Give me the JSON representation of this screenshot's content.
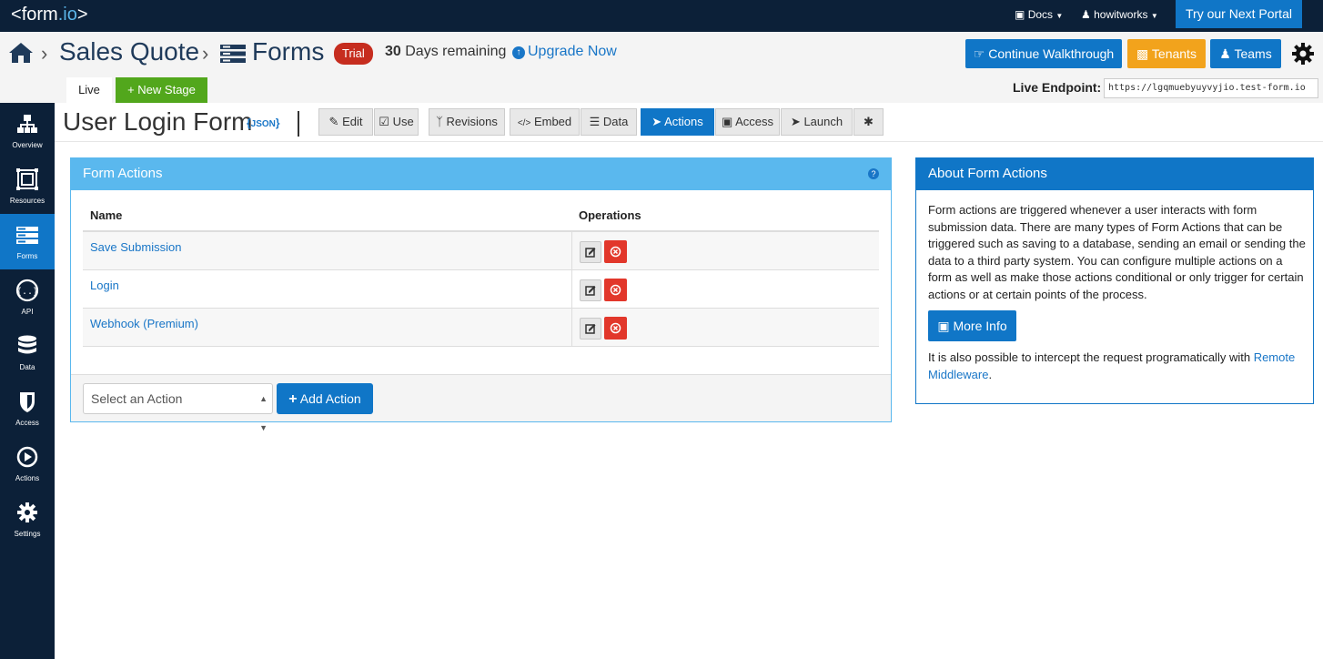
{
  "topbar": {
    "logo_prefix": "<",
    "logo_brand": "form",
    "logo_io": ".io",
    "logo_suffix": ">",
    "docs_label": "Docs",
    "user_label": "howitworks",
    "try_label": "Try our Next Portal"
  },
  "header": {
    "crumb_project": "Sales Quote",
    "crumb_forms": "Forms",
    "trial_badge": "Trial",
    "days_count": "30",
    "days_text": "Days remaining",
    "upgrade_label": "Upgrade Now",
    "walkthrough_label": "Continue Walkthrough",
    "tenants_label": "Tenants",
    "teams_label": "Teams"
  },
  "stage": {
    "live_tab": "Live",
    "new_stage_label": "+ New Stage",
    "endpoint_label": "Live Endpoint:",
    "endpoint_url": "https://lgqmuebyuyvyjio.test-form.io"
  },
  "sidebar": {
    "items": [
      {
        "label": "Overview",
        "icon": "sitemap-icon"
      },
      {
        "label": "Resources",
        "icon": "resources-icon"
      },
      {
        "label": "Forms",
        "icon": "forms-icon",
        "active": true
      },
      {
        "label": "API",
        "icon": "api-icon"
      },
      {
        "label": "Data",
        "icon": "database-icon"
      },
      {
        "label": "Access",
        "icon": "shield-icon"
      },
      {
        "label": "Actions",
        "icon": "play-icon"
      },
      {
        "label": "Settings",
        "icon": "gear-icon"
      }
    ]
  },
  "form": {
    "title": "User Login Form",
    "json_label": "JSON",
    "tabs": [
      {
        "label": "Edit",
        "icon": "edit-icon"
      },
      {
        "label": "Use",
        "icon": "check-icon"
      },
      {
        "label": "Revisions",
        "icon": "branch-icon"
      },
      {
        "label": "Embed",
        "icon": "code-icon"
      },
      {
        "label": "Data",
        "icon": "database-icon"
      },
      {
        "label": "Actions",
        "icon": "paper-plane-icon",
        "active": true
      },
      {
        "label": "Access",
        "icon": "lock-icon"
      },
      {
        "label": "Launch",
        "icon": "rocket-icon"
      },
      {
        "label": "",
        "icon": "gear-icon"
      }
    ]
  },
  "actions_panel": {
    "title": "Form Actions",
    "col_name": "Name",
    "col_operations": "Operations",
    "rows": [
      {
        "name": "Save Submission"
      },
      {
        "name": "Login"
      },
      {
        "name": "Webhook (Premium)"
      }
    ],
    "select_placeholder": "Select an Action",
    "add_label": "Add Action"
  },
  "about_panel": {
    "title": "About Form Actions",
    "paragraph": "Form actions are triggered whenever a user interacts with form submission data. There are many types of Form Actions that can be triggered such as saving to a database, sending an email or sending the data to a third party system. You can configure multiple actions on a form as well as make those actions conditional or only trigger for certain actions or at certain points of the process.",
    "more_info_label": "More Info",
    "intercept_text": "It is also possible to intercept the request programatically with",
    "middleware_link": "Remote Middleware",
    "period": "."
  },
  "colors": {
    "navy": "#0c2038",
    "primary": "#1076c7",
    "light_blue": "#5ab8ee",
    "orange": "#f2a31c",
    "green": "#52a71c",
    "red": "#e2372b",
    "trial_red": "#c62d1f"
  }
}
